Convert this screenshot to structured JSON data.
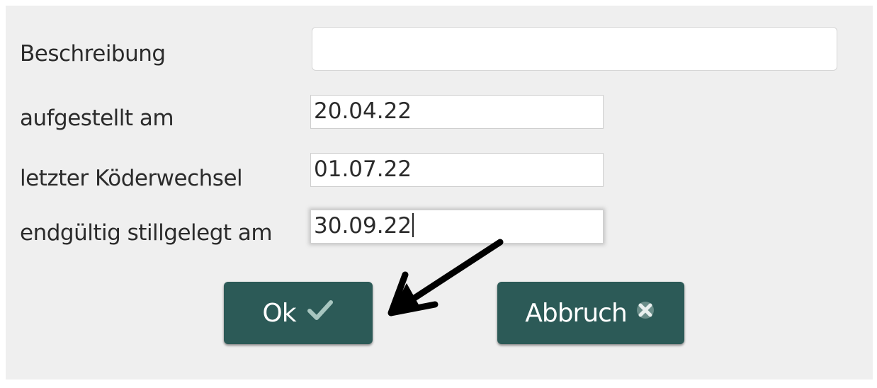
{
  "form": {
    "fields": [
      {
        "label": "Beschreibung",
        "value": ""
      },
      {
        "label": "aufgestellt am",
        "value": "20.04.22"
      },
      {
        "label": "letzter Köderwechsel",
        "value": "01.07.22"
      },
      {
        "label": "endgültig stillgelegt am",
        "value": "30.09.22"
      }
    ]
  },
  "buttons": {
    "ok_label": "Ok",
    "cancel_label": "Abbruch",
    "ok_icon": "checkmark-icon",
    "cancel_icon": "close-icon"
  },
  "colors": {
    "button_bg": "#2c5a57",
    "dialog_bg": "#efefef",
    "check_color": "#a8c6c0",
    "annotation_arrow": "#000000"
  }
}
